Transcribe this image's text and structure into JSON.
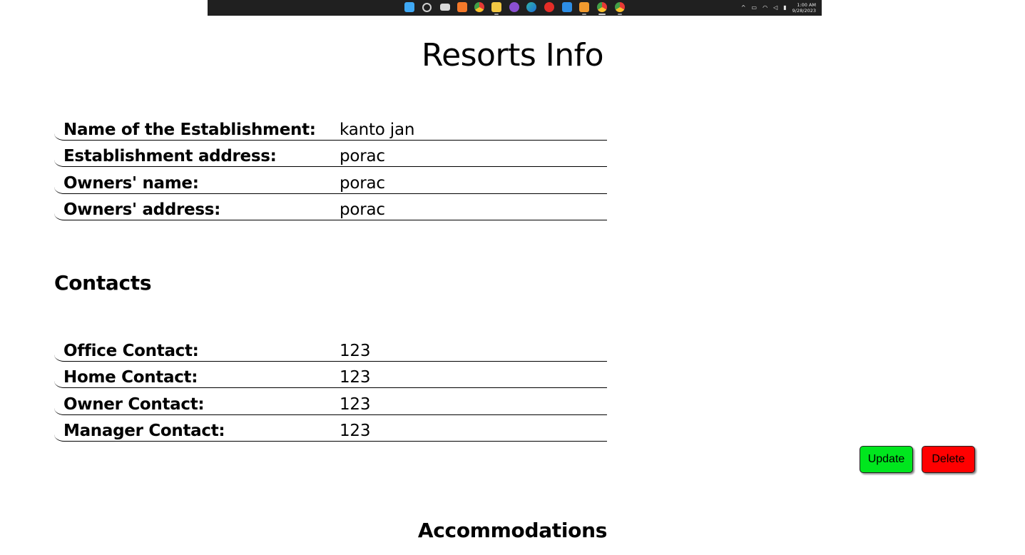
{
  "taskbar": {
    "apps": [
      {
        "name": "windows-start-icon",
        "color": "#3fa9f5"
      },
      {
        "name": "search-icon",
        "color": "#cfcfcf"
      },
      {
        "name": "task-view-icon",
        "color": "#d9d9d9"
      },
      {
        "name": "xampp-icon",
        "color": "#f5792a"
      },
      {
        "name": "chrome-icon",
        "color": "#e8b632"
      },
      {
        "name": "file-explorer-icon",
        "color": "#f3c843"
      },
      {
        "name": "app-purple-icon",
        "color": "#8b4fd1"
      },
      {
        "name": "edge-icon",
        "color": "#2fb3a6"
      },
      {
        "name": "youtube-icon",
        "color": "#e52d27"
      },
      {
        "name": "vscode-icon",
        "color": "#2d8ee6"
      },
      {
        "name": "sublime-icon",
        "color": "#f29a2e"
      },
      {
        "name": "chrome-profile-icon",
        "color": "#d6a43b"
      },
      {
        "name": "chrome-alt-icon",
        "color": "#e2b13a"
      }
    ],
    "time": "1:00 AM",
    "date": "9/28/2023"
  },
  "page": {
    "title": "Resorts Info"
  },
  "establishment": [
    {
      "label": "Name of the Establishment:",
      "value": "kanto jan"
    },
    {
      "label": "Establishment address:",
      "value": "porac"
    },
    {
      "label": "Owners' name:",
      "value": "porac"
    },
    {
      "label": "Owners' address:",
      "value": "porac"
    }
  ],
  "contacts": {
    "heading": "Contacts",
    "rows": [
      {
        "label": "Office Contact:",
        "value": "123"
      },
      {
        "label": "Home Contact:",
        "value": "123"
      },
      {
        "label": "Owner Contact:",
        "value": "123"
      },
      {
        "label": "Manager Contact:",
        "value": "123"
      }
    ]
  },
  "actions": {
    "update_label": "Update",
    "delete_label": "Delete",
    "update_color": "#00e61e",
    "delete_color": "#ff0000"
  },
  "accommodations": {
    "heading": "Accommodations"
  }
}
